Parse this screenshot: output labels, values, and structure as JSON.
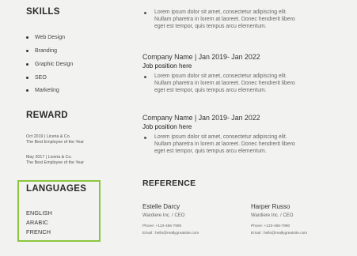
{
  "skills": {
    "title": "SKILLS",
    "items": [
      "Web Design",
      "Branding",
      "Graphic Design",
      "SEO",
      "Marketing"
    ]
  },
  "reward": {
    "title": "REWARD",
    "items": [
      {
        "line1": "Oct 2019 | Liceria & Co.",
        "line2": "The Best Employee of the Year"
      },
      {
        "line1": "May 2017 | Liceria & Co.",
        "line2": "The Best Employee of the Year"
      }
    ]
  },
  "languages": {
    "title": "LANGUAGES",
    "items": [
      "ENGLISH",
      "ARABIC",
      "FRENCH"
    ]
  },
  "experience": {
    "top_bullet": [
      "Lorem ipsum dolor sit amet, consectetur adipiscing elit.",
      "Nullam pharetra in lorem at laoreet. Donec hendrerit libero",
      "eget est tempor, quis tempus arcu elementum."
    ],
    "entries": [
      {
        "company": "Company Name | Jan 2019- Jan 2022",
        "position": "Job position here",
        "bullet": [
          "Lorem ipsum dolor sit amet, consectetur adipiscing elit.",
          "Nullam pharetra in lorem at laoreet. Donec hendrerit libero",
          "eget est tempor, quis tempus arcu elementum."
        ]
      },
      {
        "company": "Company Name | Jan 2019- Jan 2022",
        "position": "Job position here",
        "bullet": [
          "Lorem ipsum dolor sit amet, consectetur adipiscing elit.",
          "Nullam pharetra in lorem at laoreet. Donec hendrerit libero",
          "eget est tempor, quis tempus arcu elementum."
        ]
      }
    ]
  },
  "reference": {
    "title": "REFERENCE",
    "people": [
      {
        "name": "Estelle Darcy",
        "org": "Wardiere Inc. / CEO",
        "phone": "Phone:  +123-456-7890",
        "email": "Email :  hello@reallygreatsite.com"
      },
      {
        "name": "Harper Russo",
        "org": "Wardiere Inc. / CEO",
        "phone": "Phone:   +123-456-7890",
        "email": "Email :   hello@reallygreatsite.com"
      }
    ]
  },
  "colors": {
    "highlight": "#8cc63f",
    "background": "#f2f2f0"
  }
}
